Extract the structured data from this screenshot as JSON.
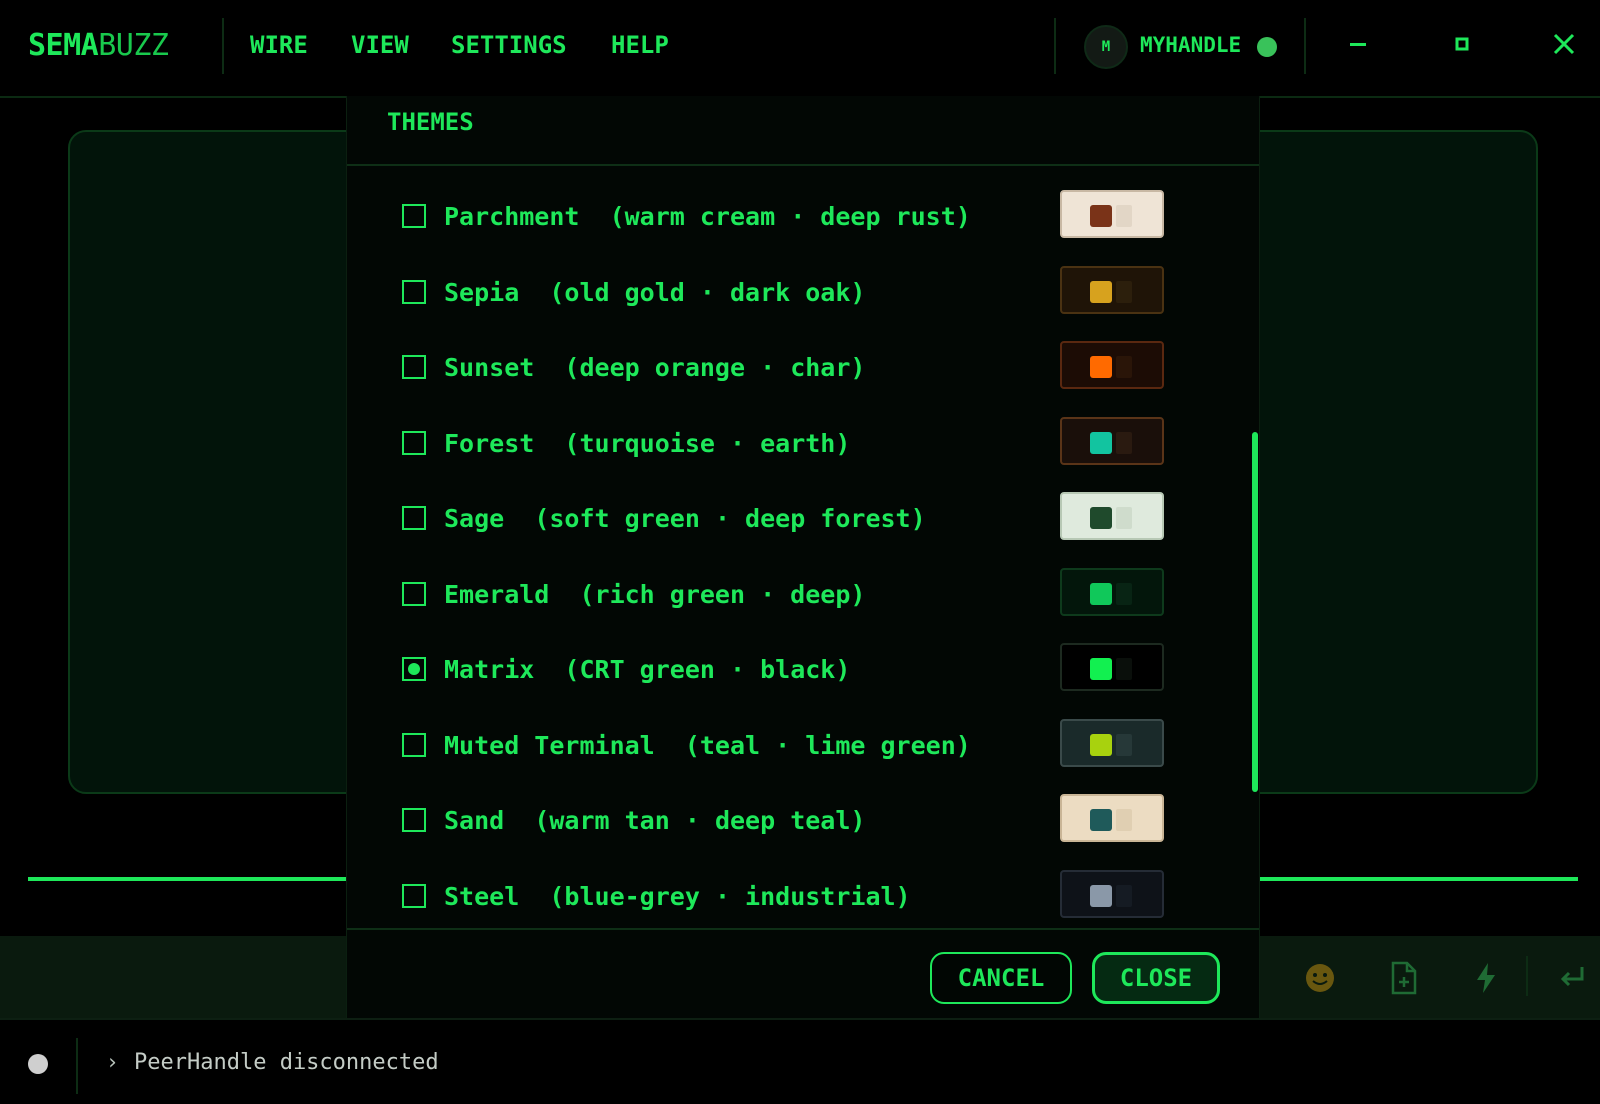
{
  "app": {
    "brand_a": "SEMA",
    "brand_b": "BUZZ"
  },
  "menu": [
    "WIRE",
    "VIEW",
    "SETTINGS",
    "HELP"
  ],
  "user": {
    "avatar_initial": "M",
    "handle": "MYHANDLE",
    "status_color": "#39c25a"
  },
  "modal": {
    "title": "THEMES",
    "themes": [
      {
        "name": "Parchment",
        "desc": "(warm cream · deep rust)",
        "checked": false,
        "bg": "#efe4d6",
        "border": "#c8b8a4",
        "primary": "#7a3318",
        "secondary": "#e2d6c6"
      },
      {
        "name": "Sepia",
        "desc": "(old gold · dark oak)",
        "checked": false,
        "bg": "#1f1407",
        "border": "#4a3212",
        "primary": "#d7a21e",
        "secondary": "#2c1f0c"
      },
      {
        "name": "Sunset",
        "desc": "(deep orange · char)",
        "checked": false,
        "bg": "#1c0c05",
        "border": "#5a2810",
        "primary": "#ff6a00",
        "secondary": "#2a1508"
      },
      {
        "name": "Forest",
        "desc": "(turquoise · earth)",
        "checked": false,
        "bg": "#1a0f0a",
        "border": "#5a3418",
        "primary": "#12c4a0",
        "secondary": "#2a1a10"
      },
      {
        "name": "Sage",
        "desc": "(soft green · deep forest)",
        "checked": false,
        "bg": "#dfeadd",
        "border": "#b7c8b4",
        "primary": "#1f4a2c",
        "secondary": "#cfdccc"
      },
      {
        "name": "Emerald",
        "desc": "(rich green · deep)",
        "checked": false,
        "bg": "#03160b",
        "border": "#0e3a1c",
        "primary": "#10c85a",
        "secondary": "#082414"
      },
      {
        "name": "Matrix",
        "desc": "(CRT green · black)",
        "checked": true,
        "bg": "#000000",
        "border": "#1d2a20",
        "primary": "#12f050",
        "secondary": "#0a0f0b"
      },
      {
        "name": "Muted Terminal",
        "desc": "(teal · lime green)",
        "checked": false,
        "bg": "#1a2a2a",
        "border": "#3a4a4a",
        "primary": "#a8d20e",
        "secondary": "#263838"
      },
      {
        "name": "Sand",
        "desc": "(warm tan · deep teal)",
        "checked": false,
        "bg": "#ecdcc2",
        "border": "#c9b596",
        "primary": "#1f5a5a",
        "secondary": "#e0cfb2"
      },
      {
        "name": "Steel",
        "desc": "(blue-grey · industrial)",
        "checked": false,
        "bg": "#0e1218",
        "border": "#252c36",
        "primary": "#8a98a8",
        "secondary": "#151b23"
      }
    ],
    "cancel_label": "CANCEL",
    "close_label": "CLOSE"
  },
  "status": {
    "prompt": "›",
    "message": "PeerHandle disconnected"
  },
  "colors": {
    "accent": "#1ee85a",
    "background": "#000000"
  }
}
